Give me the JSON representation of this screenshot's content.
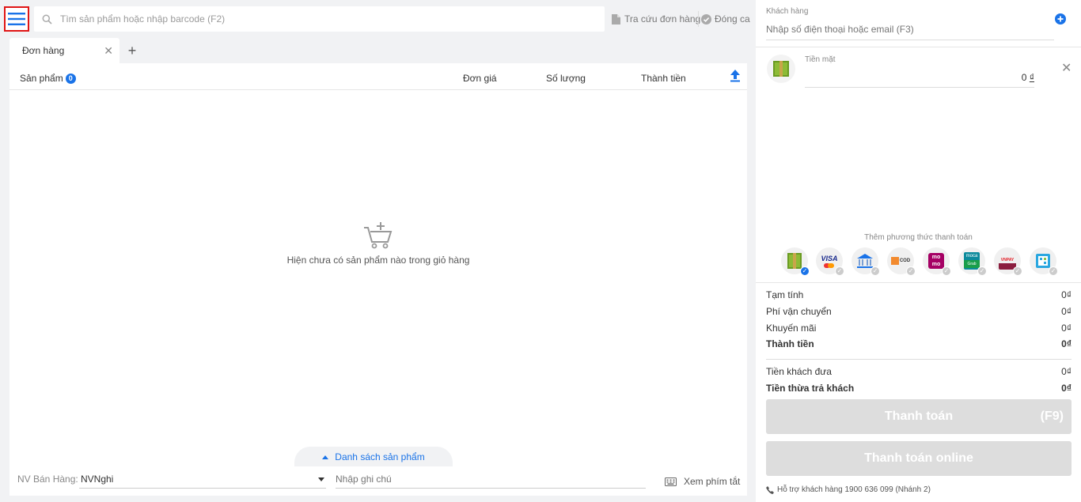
{
  "search": {
    "placeholder": "Tìm sản phẩm hoặc nhập barcode (F2)"
  },
  "top": {
    "lookup_label": "Tra cứu đơn hàng",
    "close_shift_label": "Đóng ca"
  },
  "tabs": [
    {
      "label": "Đơn hàng"
    }
  ],
  "table": {
    "col_product": "Sản phẩm",
    "product_count": "0",
    "col_price": "Đơn giá",
    "col_qty": "Số lượng",
    "col_total": "Thành tiền"
  },
  "empty_message": "Hiện chưa có sản phẩm nào trong giỏ hàng",
  "product_list_label": "Danh sách sản phẩm",
  "bottom": {
    "staff_label": "NV Bán Hàng:",
    "staff_value": "NVNghi",
    "note_placeholder": "Nhập ghi chú",
    "shortcuts_label": "Xem phím tắt"
  },
  "customer": {
    "label": "Khách hàng",
    "placeholder": "Nhập số điện thoại hoặc email (F3)"
  },
  "payment": {
    "cash_label": "Tiền mặt",
    "cash_value": "0",
    "currency": "₫",
    "add_method_label": "Thêm phương thức thanh toán",
    "methods": [
      {
        "icon": "cash-icon",
        "selected": true
      },
      {
        "icon": "visa-icon",
        "text": "VISA",
        "selected": false
      },
      {
        "icon": "bank-icon",
        "selected": false
      },
      {
        "icon": "cod-icon",
        "text": "COD",
        "selected": false
      },
      {
        "icon": "momo-icon",
        "text": "mo mo",
        "selected": false
      },
      {
        "icon": "moca-icon",
        "text": "moca",
        "selected": false
      },
      {
        "icon": "vnpay-icon",
        "text": "VNPAY",
        "selected": false
      },
      {
        "icon": "qr-icon",
        "selected": false
      }
    ]
  },
  "summary": {
    "subtotal_label": "Tạm tính",
    "subtotal": "0₫",
    "shipping_label": "Phí vận chuyển",
    "shipping": "0₫",
    "discount_label": "Khuyến mãi",
    "discount": "0₫",
    "total_label": "Thành tiền",
    "total": "0₫",
    "paid_label": "Tiền khách đưa",
    "paid": "0₫",
    "change_label": "Tiền thừa trả khách",
    "change": "0₫"
  },
  "actions": {
    "pay_label": "Thanh toán",
    "pay_shortcut": "(F9)",
    "pay_online_label": "Thanh toán online"
  },
  "support": "Hỗ trợ khách hàng 1900 636 099 (Nhánh 2)",
  "colors": {
    "accent": "#1a73e8",
    "highlight_border": "#e01515",
    "disabled_button": "#dddddd"
  }
}
